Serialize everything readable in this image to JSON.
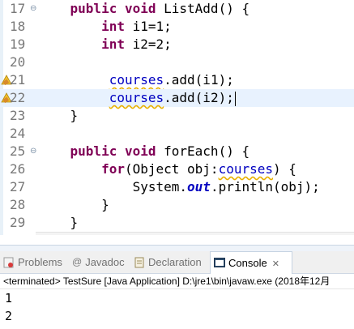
{
  "editor": {
    "lines": [
      {
        "num": "17",
        "indent": "    ",
        "segments": [
          {
            "t": "kw",
            "v": "public"
          },
          {
            "t": "p",
            "v": " "
          },
          {
            "t": "kw",
            "v": "void"
          },
          {
            "t": "p",
            "v": " ListAdd() {"
          }
        ],
        "fold": true
      },
      {
        "num": "18",
        "indent": "        ",
        "segments": [
          {
            "t": "kw",
            "v": "int"
          },
          {
            "t": "p",
            "v": " i1=1;"
          }
        ]
      },
      {
        "num": "19",
        "indent": "        ",
        "segments": [
          {
            "t": "kw",
            "v": "int"
          },
          {
            "t": "p",
            "v": " i2=2;"
          }
        ]
      },
      {
        "num": "20",
        "indent": "",
        "segments": []
      },
      {
        "num": "21",
        "indent": "         ",
        "segments": [
          {
            "t": "w",
            "v": "courses"
          },
          {
            "t": "p",
            "v": ".add(i1);"
          }
        ],
        "marker": "warning-edit"
      },
      {
        "num": "22",
        "indent": "         ",
        "segments": [
          {
            "t": "w",
            "v": "courses"
          },
          {
            "t": "p",
            "v": ".add(i2);"
          }
        ],
        "marker": "warning-edit",
        "current": true,
        "caret": true
      },
      {
        "num": "23",
        "indent": "    ",
        "segments": [
          {
            "t": "p",
            "v": "}"
          }
        ]
      },
      {
        "num": "24",
        "indent": "",
        "segments": []
      },
      {
        "num": "25",
        "indent": "    ",
        "segments": [
          {
            "t": "kw",
            "v": "public"
          },
          {
            "t": "p",
            "v": " "
          },
          {
            "t": "kw",
            "v": "void"
          },
          {
            "t": "p",
            "v": " forEach() {"
          }
        ],
        "fold": true
      },
      {
        "num": "26",
        "indent": "        ",
        "segments": [
          {
            "t": "kw",
            "v": "for"
          },
          {
            "t": "p",
            "v": "(Object obj:"
          },
          {
            "t": "w",
            "v": "courses"
          },
          {
            "t": "p",
            "v": ") {"
          }
        ]
      },
      {
        "num": "27",
        "indent": "            ",
        "segments": [
          {
            "t": "p",
            "v": "System."
          },
          {
            "t": "f",
            "v": "out"
          },
          {
            "t": "p",
            "v": ".println(obj);"
          }
        ]
      },
      {
        "num": "28",
        "indent": "        ",
        "segments": [
          {
            "t": "p",
            "v": "}"
          }
        ]
      },
      {
        "num": "29",
        "indent": "    ",
        "segments": [
          {
            "t": "p",
            "v": "}"
          }
        ]
      }
    ],
    "fold_symbol": "⊖",
    "scroll_left_symbol": "<"
  },
  "tabs": [
    {
      "label": "Problems",
      "icon": "problems-icon"
    },
    {
      "label": "Javadoc",
      "icon": "javadoc-icon"
    },
    {
      "label": "Declaration",
      "icon": "declaration-icon"
    },
    {
      "label": "Console",
      "icon": "console-icon",
      "active": true,
      "close": "✕"
    }
  ],
  "console": {
    "terminated": "<terminated> TestSure [Java Application] D:\\jre1\\bin\\javaw.exe (2018年12月",
    "output": [
      "1",
      "2"
    ]
  },
  "colors": {
    "keyword": "#7f0055",
    "field": "#0000c0",
    "current_line": "#e8f2fe",
    "warning_underline": "#e8b000"
  }
}
